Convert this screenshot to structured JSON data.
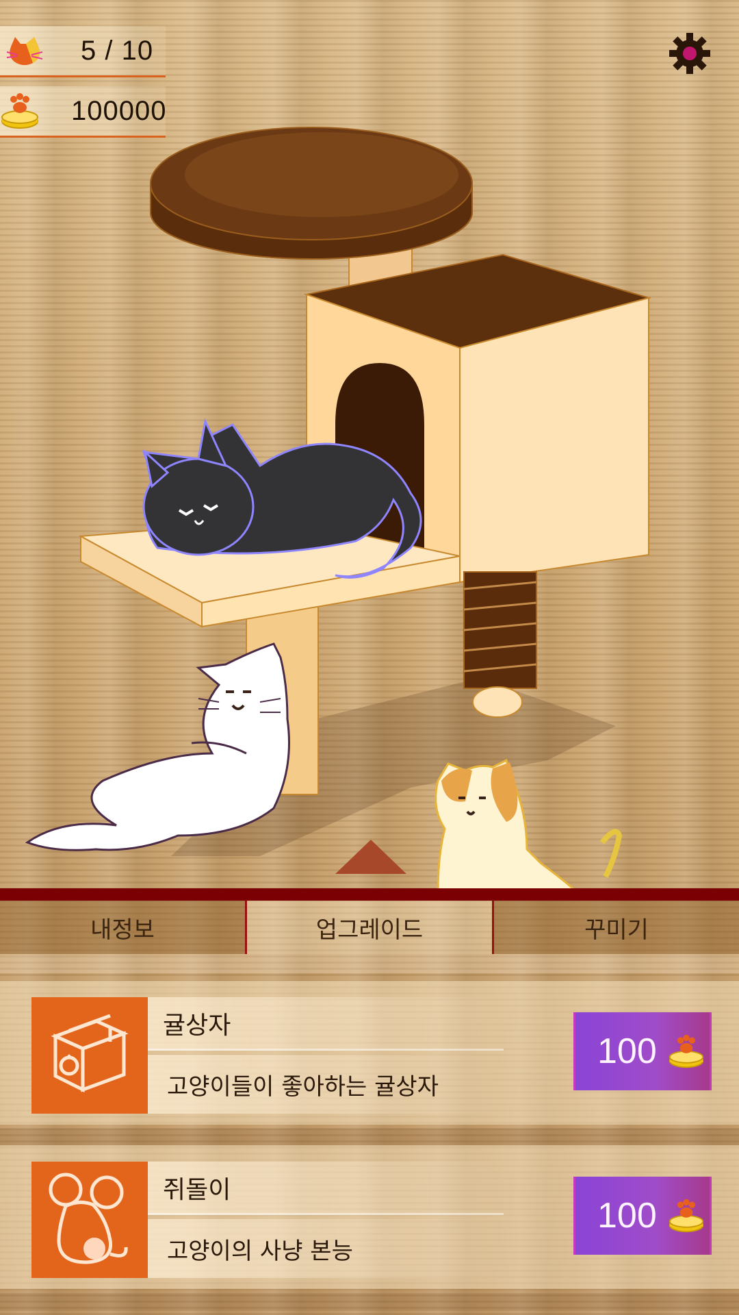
{
  "hud": {
    "cats": "5 / 10",
    "coins": "100000"
  },
  "icons": {
    "cats": "cat-head-icon",
    "coins": "paw-coin-icon",
    "settings": "gear-icon",
    "scroll": "triangle-up-icon"
  },
  "tabs": [
    {
      "label": "내정보",
      "active": false
    },
    {
      "label": "업그레이드",
      "active": true
    },
    {
      "label": "꾸미기",
      "active": false
    }
  ],
  "upgrades": [
    {
      "name": "귤상자",
      "description": "고양이들이 좋아하는 귤상자",
      "price": "100",
      "icon": "box-icon"
    },
    {
      "name": "쥐돌이",
      "description": "고양이의 사냥 본능",
      "price": "100",
      "icon": "mouse-toy-icon"
    }
  ],
  "colors": {
    "accent_orange": "#e2651b",
    "tab_bar": "#7b0004",
    "buy_button": "#8a44d6"
  }
}
